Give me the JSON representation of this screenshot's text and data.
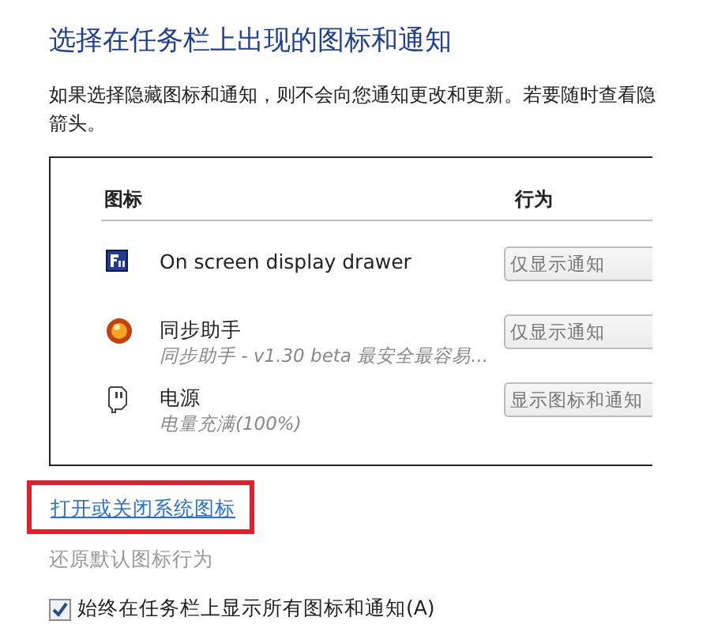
{
  "title": "选择在任务栏上出现的图标和通知",
  "description": [
    "如果选择隐藏图标和通知，则不会向您通知更改和更新。若要随时查看隐",
    "箭头。"
  ],
  "table": {
    "columns": [
      "图标",
      "行为"
    ],
    "rows": [
      {
        "kind": "fn",
        "name": "On screen display drawer",
        "behavior": "仅显示通知"
      },
      {
        "kind": "orb",
        "name": "同步助手",
        "detail": "同步助手 - v1.30 beta  最安全最容易...",
        "behavior": "仅显示通知"
      },
      {
        "kind": "plug",
        "name": "电源",
        "detail": "电量充满(100%)",
        "behavior": "显示图标和通知"
      }
    ]
  },
  "system_icons_link": {
    "label": "打开或关闭系统图标",
    "highlighted": true
  },
  "restore_link": {
    "label": "还原默认图标行为",
    "disabled": true
  },
  "always_show": {
    "label": "始终在任务栏上显示所有图标和通知(A)",
    "checked": true
  }
}
